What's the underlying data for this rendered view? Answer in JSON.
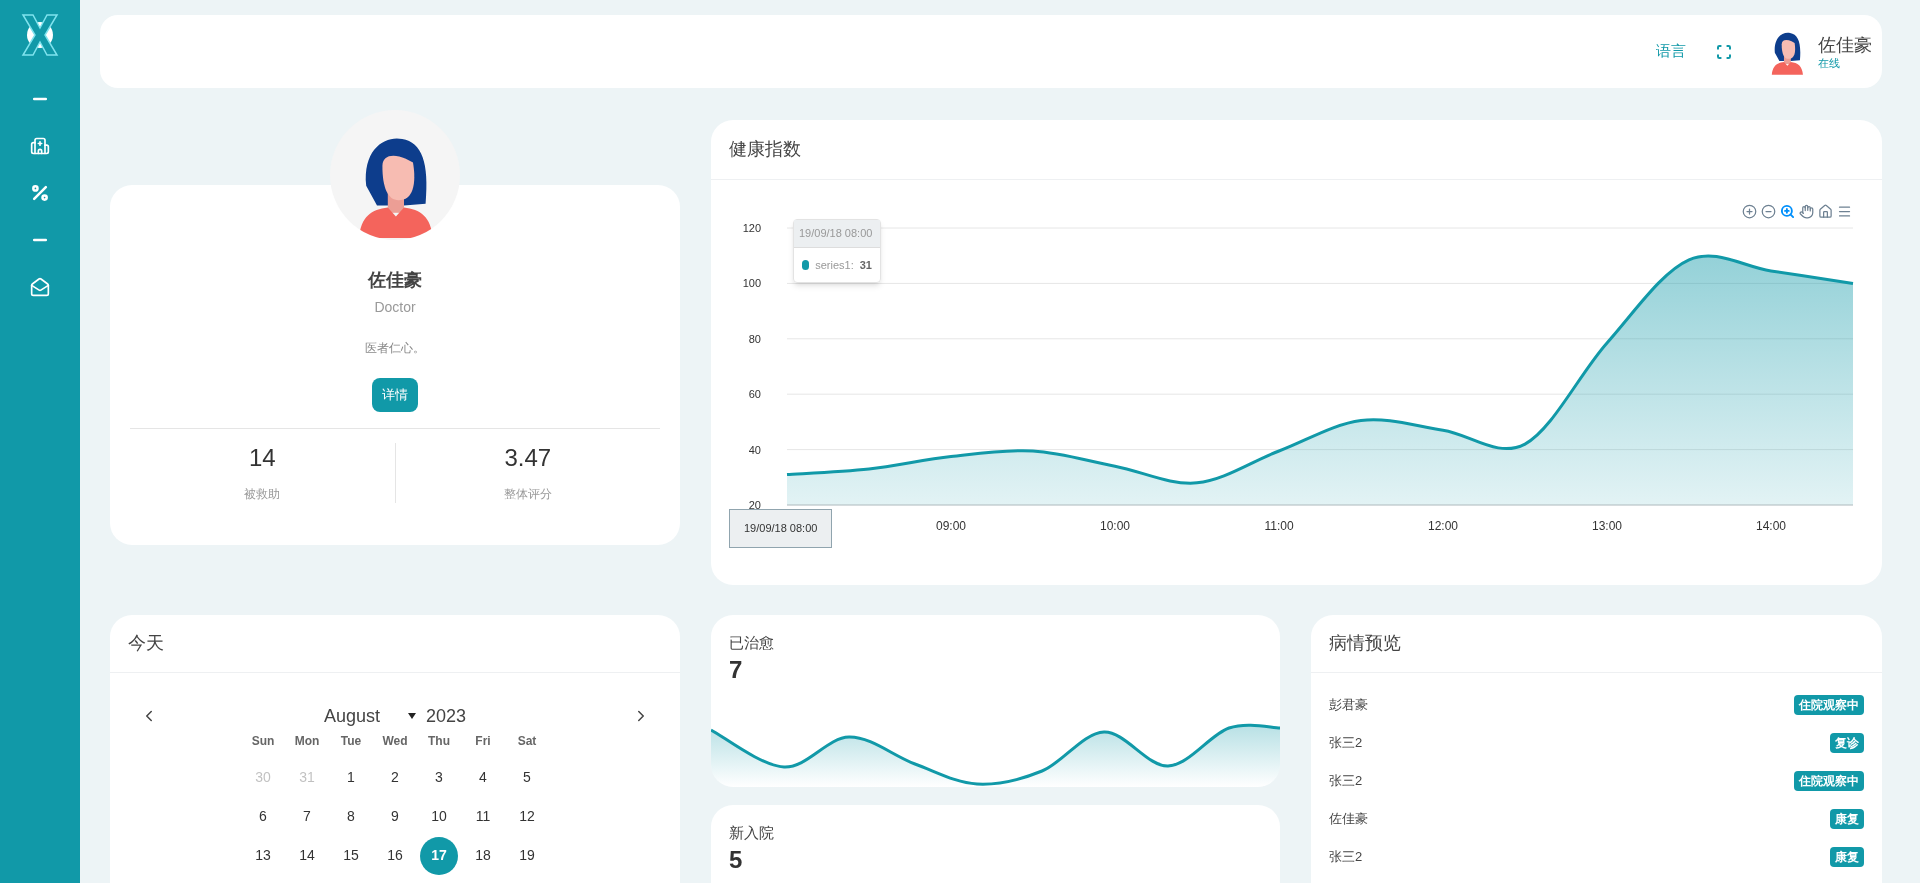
{
  "sidebar": {
    "items": [
      {
        "kind": "logo"
      },
      {
        "kind": "minus"
      },
      {
        "kind": "hospital"
      },
      {
        "kind": "percent"
      },
      {
        "kind": "minus"
      },
      {
        "kind": "mail"
      }
    ]
  },
  "header": {
    "language": "语言",
    "user": {
      "name": "佐佳豪",
      "status": "在线"
    }
  },
  "profile": {
    "name": "佐佳豪",
    "role": "Doctor",
    "motto": "医者仁心。",
    "button": "详情",
    "stats": [
      {
        "value": "14",
        "label": "被救助"
      },
      {
        "value": "3.47",
        "label": "整体评分"
      }
    ]
  },
  "health": {
    "title": "健康指数",
    "toolbar": [
      {
        "kind": "zoom-in",
        "selected": false
      },
      {
        "kind": "zoom-out",
        "selected": false
      },
      {
        "kind": "zoom",
        "selected": true
      },
      {
        "kind": "pan",
        "selected": false
      },
      {
        "kind": "home",
        "selected": false
      },
      {
        "kind": "menu",
        "selected": false
      }
    ],
    "tooltip": {
      "title": "19/09/18 08:00",
      "series": "series1:",
      "value": "31"
    },
    "crosshair_label": "19/09/18 08:00",
    "chart_data": {
      "type": "area",
      "grid": true,
      "x": [
        8,
        8.5,
        9,
        9.5,
        10,
        10.5,
        11,
        11.5,
        12,
        12.5,
        13,
        13.5,
        14,
        14.5
      ],
      "series": [
        {
          "color": "#1199a8",
          "values": [
            31,
            33,
            37.5,
            39.5,
            34,
            28,
            39.5,
            50.5,
            47,
            42,
            78.5,
            108.5,
            104.5,
            100
          ]
        }
      ],
      "xlim": [
        8,
        14.5
      ],
      "ylim": [
        20,
        120
      ],
      "yticks": [
        20,
        40,
        60,
        80,
        100,
        120
      ],
      "xticks": [
        {
          "value": 9,
          "label": "09:00"
        },
        {
          "value": 10,
          "label": "10:00"
        },
        {
          "value": 11,
          "label": "11:00"
        },
        {
          "value": 12,
          "label": "12:00"
        },
        {
          "value": 13,
          "label": "13:00"
        },
        {
          "value": 14,
          "label": "14:00"
        }
      ]
    }
  },
  "calendar": {
    "title": "今天",
    "month": "August",
    "year": "2023",
    "weekdays": [
      "Sun",
      "Mon",
      "Tue",
      "Wed",
      "Thu",
      "Fri",
      "Sat"
    ],
    "weeks": [
      [
        {
          "day": "30",
          "outside": true,
          "selected": false
        },
        {
          "day": "31",
          "outside": true,
          "selected": false
        },
        {
          "day": "1",
          "outside": false,
          "selected": false
        },
        {
          "day": "2",
          "outside": false,
          "selected": false
        },
        {
          "day": "3",
          "outside": false,
          "selected": false
        },
        {
          "day": "4",
          "outside": false,
          "selected": false
        },
        {
          "day": "5",
          "outside": false,
          "selected": false
        }
      ],
      [
        {
          "day": "6",
          "outside": false,
          "selected": false
        },
        {
          "day": "7",
          "outside": false,
          "selected": false
        },
        {
          "day": "8",
          "outside": false,
          "selected": false
        },
        {
          "day": "9",
          "outside": false,
          "selected": false
        },
        {
          "day": "10",
          "outside": false,
          "selected": false
        },
        {
          "day": "11",
          "outside": false,
          "selected": false
        },
        {
          "day": "12",
          "outside": false,
          "selected": false
        }
      ],
      [
        {
          "day": "13",
          "outside": false,
          "selected": false
        },
        {
          "day": "14",
          "outside": false,
          "selected": false
        },
        {
          "day": "15",
          "outside": false,
          "selected": false
        },
        {
          "day": "16",
          "outside": false,
          "selected": false
        },
        {
          "day": "17",
          "outside": false,
          "selected": true
        },
        {
          "day": "18",
          "outside": false,
          "selected": false
        },
        {
          "day": "19",
          "outside": false,
          "selected": false
        }
      ]
    ]
  },
  "stats": [
    {
      "title": "已治愈",
      "value": "7",
      "sparkline": true
    },
    {
      "title": "新入院",
      "value": "5"
    }
  ],
  "conditions": {
    "title": "病情预览",
    "rows": [
      {
        "name": "彭君豪",
        "status": "住院观察中"
      },
      {
        "name": "张三2",
        "status": "复诊"
      },
      {
        "name": "张三2",
        "status": "住院观察中"
      },
      {
        "name": "佐佳豪",
        "status": "康复"
      },
      {
        "name": "张三2",
        "status": "康复"
      }
    ]
  }
}
